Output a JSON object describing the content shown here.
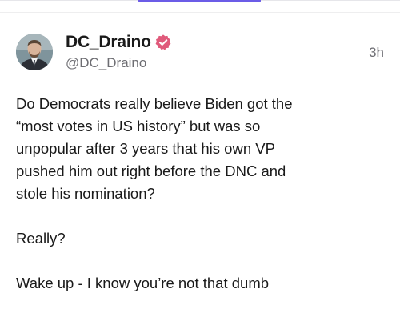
{
  "post": {
    "author": {
      "display_name": "DC_Draino",
      "handle": "@DC_Draino",
      "verified": true,
      "verified_color": "#e05a7b",
      "avatar_icon": "profile-photo"
    },
    "timestamp": "3h",
    "paragraphs": [
      "Do Democrats really believe Biden got the\n“most votes in US history” but was so\nunpopular after 3 years that his own VP\npushed him out right before the DNC and\nstole his nomination?",
      "Really?",
      "Wake up - I know you’re not that dumb"
    ]
  },
  "theme": {
    "accent": "#6b5ce7",
    "text": "#1a1a1a",
    "muted": "#6d6d72"
  }
}
